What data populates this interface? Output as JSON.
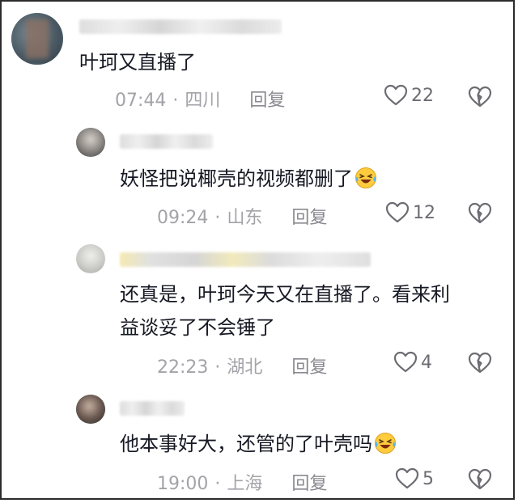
{
  "comments": [
    {
      "text": "叶珂又直播了",
      "time": "07:44",
      "location": "四川",
      "reply_label": "回复",
      "likes": "22",
      "emoji": false
    },
    {
      "text": "妖怪把说椰壳的视频都删了",
      "time": "09:24",
      "location": "山东",
      "reply_label": "回复",
      "likes": "12",
      "emoji": true
    },
    {
      "text_line1": "还真是，叶珂今天又在直播了。看来利",
      "text_line2": "益谈妥了不会锤了",
      "time": "22:23",
      "location": "湖北",
      "reply_label": "回复",
      "likes": "4",
      "emoji": false
    },
    {
      "text": "他本事好大，还管的了叶壳吗",
      "time": "19:00",
      "location": "上海",
      "reply_label": "回复",
      "likes": "5",
      "emoji": true
    }
  ],
  "separator": "·",
  "colors": {
    "text": "#161823",
    "meta": "#a3a3a8",
    "icon": "#6c6c72",
    "emoji_face": "#ffcc3d"
  },
  "icons": {
    "like": "heart-outline-icon",
    "dislike": "broken-heart-icon",
    "emoji": "laughing-crying-emoji-icon"
  }
}
